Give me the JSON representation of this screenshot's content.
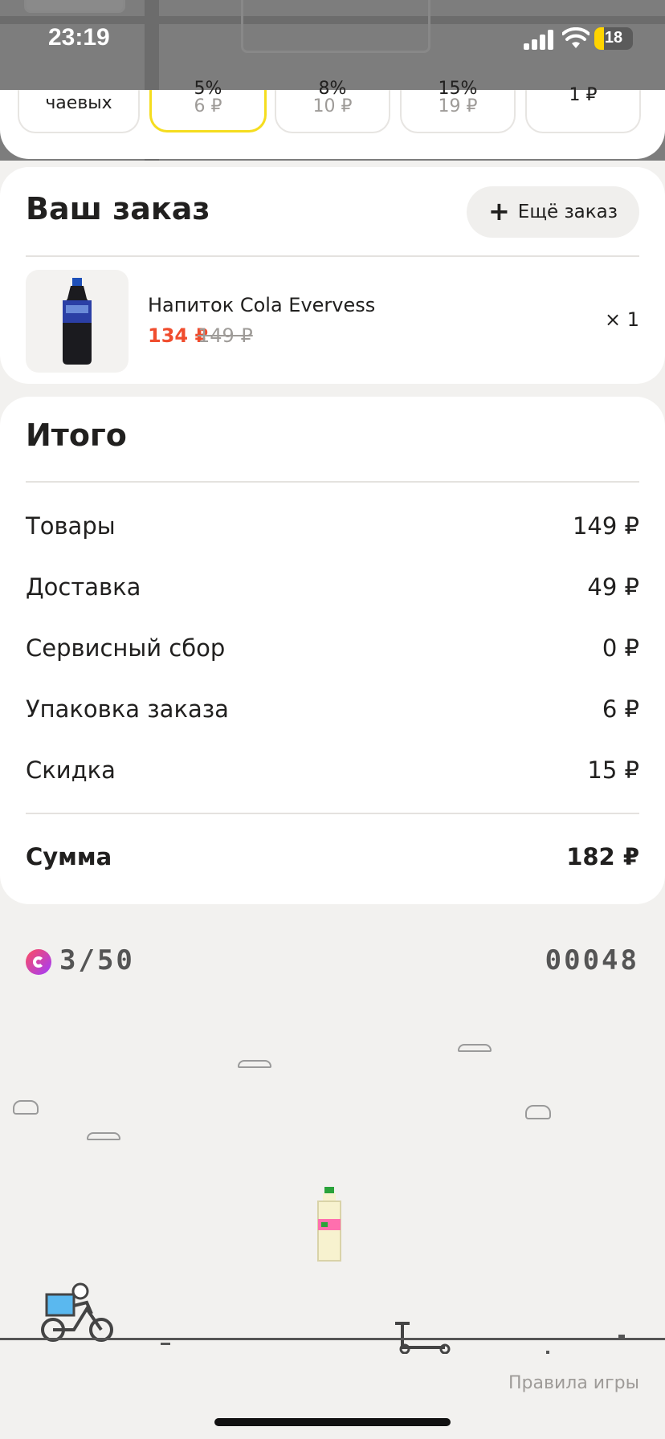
{
  "status": {
    "time": "23:19",
    "battery": "18"
  },
  "tips": {
    "items": [
      {
        "label": "чаевых",
        "value": ""
      },
      {
        "label": "5%",
        "value": "6 ₽"
      },
      {
        "label": "8%",
        "value": "10 ₽"
      },
      {
        "label": "15%",
        "value": "19 ₽"
      },
      {
        "label": "1 ₽",
        "value": ""
      }
    ],
    "selected_index": 1
  },
  "order": {
    "title": "Ваш заказ",
    "more_button": "Ещё заказ",
    "item": {
      "name": "Напиток Cola Evervess",
      "price_new": "134 ₽",
      "price_old": "149 ₽",
      "qty": "× 1"
    }
  },
  "total": {
    "title": "Итого",
    "rows": [
      {
        "label": "Товары",
        "value": "149 ₽"
      },
      {
        "label": "Доставка",
        "value": "49 ₽"
      },
      {
        "label": "Сервисный сбор",
        "value": "0 ₽"
      },
      {
        "label": "Упаковка заказа",
        "value": "6 ₽"
      },
      {
        "label": "Скидка",
        "value": "15 ₽"
      }
    ],
    "sum": {
      "label": "Сумма",
      "value": "182 ₽"
    }
  },
  "game": {
    "coins": "3/50",
    "score": "00048",
    "rules": "Правила игры"
  },
  "colors": {
    "accent_yellow": "#f5dd1f",
    "price_red": "#f04d2e"
  }
}
